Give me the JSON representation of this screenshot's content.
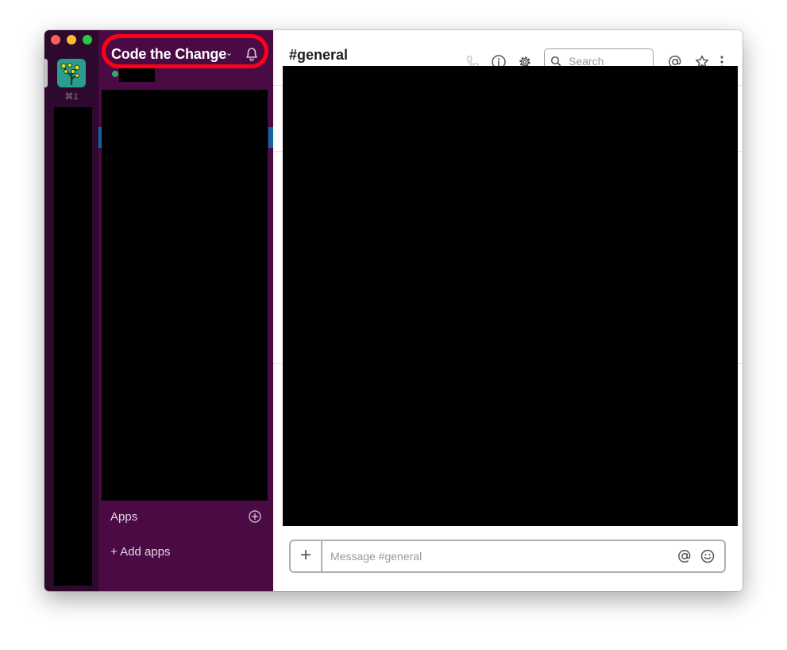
{
  "team": {
    "name": "Code the Change",
    "shortcut": "⌘1"
  },
  "sidebar": {
    "apps_label": "Apps",
    "add_apps_label": "+ Add apps"
  },
  "channel": {
    "title": "#general"
  },
  "search": {
    "placeholder": "Search"
  },
  "composer": {
    "attach_label": "+",
    "placeholder": "Message #general"
  },
  "colors": {
    "sidebar": "#4a0a44",
    "team_rail": "#2d0a2d",
    "highlight": "#ff0018",
    "accent": "#1264a3",
    "presence": "#2bac76"
  }
}
